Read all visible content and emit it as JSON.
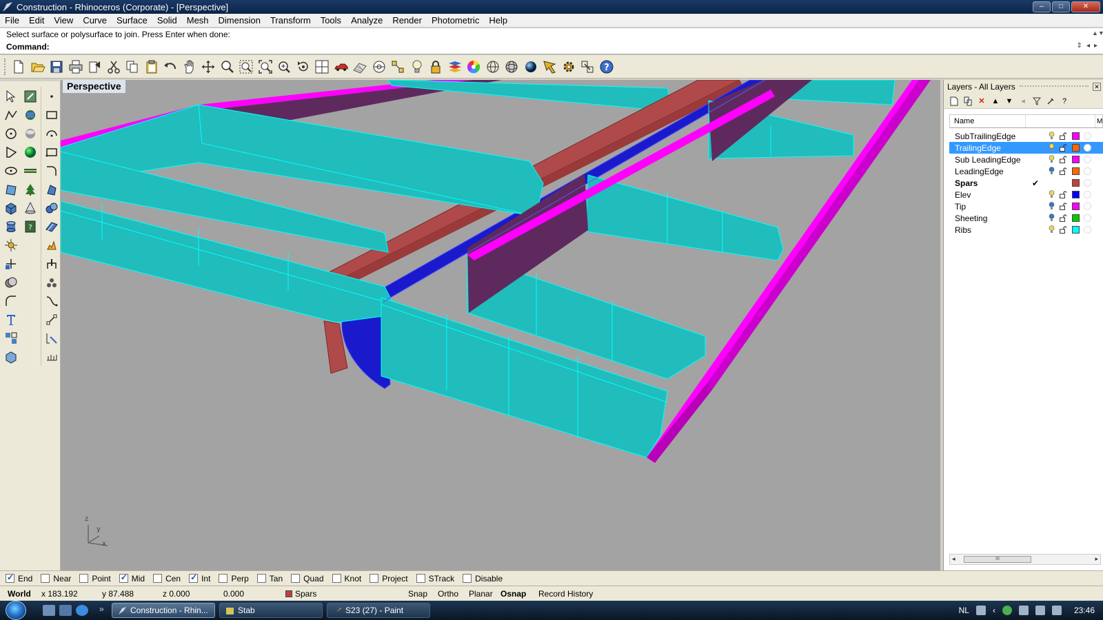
{
  "window": {
    "title": "Construction - Rhinoceros (Corporate) - [Perspective]",
    "controls": [
      "–",
      "□",
      "✕"
    ]
  },
  "menu": [
    "File",
    "Edit",
    "View",
    "Curve",
    "Surface",
    "Solid",
    "Mesh",
    "Dimension",
    "Transform",
    "Tools",
    "Analyze",
    "Render",
    "Photometric",
    "Help"
  ],
  "command": {
    "history": "Select surface or polysurface to join. Press Enter when done:",
    "prompt": "Command:"
  },
  "toolbar_icons": [
    "new-icon",
    "open-icon",
    "save-icon",
    "print-icon",
    "export-icon",
    "cut-icon",
    "copy-icon",
    "paste-icon",
    "undo-icon",
    "pan-hand-icon",
    "rotate-view-icon",
    "zoom-icon",
    "zoom-window-icon",
    "zoom-extents-icon",
    "zoom-selected-icon",
    "undo-view-icon",
    "four-viewports-icon",
    "car-icon",
    "grid-icon",
    "target-icon",
    "select-points-icon",
    "lightbulb-icon",
    "lock-icon",
    "layer-icon",
    "color-wheel-icon",
    "wireframe-sphere-icon",
    "mesh-sphere-icon",
    "render-sphere-icon",
    "analysis-icon",
    "options-gear-icon",
    "snap-icon",
    "help-icon"
  ],
  "viewport": {
    "title": "Perspective",
    "axes": {
      "x": "x",
      "y": "y",
      "z": "z"
    }
  },
  "layers_panel": {
    "title": "Layers - All Layers",
    "column_name": "Name",
    "column_more": "M",
    "layers": [
      {
        "name": "SubTrailingEdge",
        "color": "#ff00ff",
        "bulb": "#e8d85a",
        "selected": false,
        "current": false,
        "check": ""
      },
      {
        "name": "TrailingEdge",
        "color": "#ff6600",
        "bulb": "#e8d85a",
        "selected": true,
        "current": false,
        "check": ""
      },
      {
        "name": "Sub LeadingEdge",
        "color": "#ff00ff",
        "bulb": "#e8d85a",
        "selected": false,
        "current": false,
        "check": ""
      },
      {
        "name": "LeadingEdge",
        "color": "#ff6600",
        "bulb": "#3a78c8",
        "selected": false,
        "current": false,
        "check": ""
      },
      {
        "name": "Spars",
        "color": "#c04040",
        "bulb": "",
        "selected": false,
        "current": true,
        "check": "✔"
      },
      {
        "name": "Elev",
        "color": "#0000ff",
        "bulb": "#e8d85a",
        "selected": false,
        "current": false,
        "check": ""
      },
      {
        "name": "Tip",
        "color": "#ff00ff",
        "bulb": "#3a78c8",
        "selected": false,
        "current": false,
        "check": ""
      },
      {
        "name": "Sheeting",
        "color": "#00cc00",
        "bulb": "#3a78c8",
        "selected": false,
        "current": false,
        "check": ""
      },
      {
        "name": "Ribs",
        "color": "#00ffff",
        "bulb": "#e8d85a",
        "selected": false,
        "current": false,
        "check": ""
      }
    ],
    "scroll_thumb": "III"
  },
  "osnaps": [
    {
      "label": "End",
      "checked": true
    },
    {
      "label": "Near",
      "checked": false
    },
    {
      "label": "Point",
      "checked": false
    },
    {
      "label": "Mid",
      "checked": true
    },
    {
      "label": "Cen",
      "checked": false
    },
    {
      "label": "Int",
      "checked": true
    },
    {
      "label": "Perp",
      "checked": false
    },
    {
      "label": "Tan",
      "checked": false
    },
    {
      "label": "Quad",
      "checked": false
    },
    {
      "label": "Knot",
      "checked": false
    },
    {
      "label": "Project",
      "checked": false
    },
    {
      "label": "STrack",
      "checked": false
    },
    {
      "label": "Disable",
      "checked": false
    }
  ],
  "status": {
    "cplane": "World",
    "x": "x 183.192",
    "y": "y 87.488",
    "z": "z 0.000",
    "distance": "0.000",
    "layer": "Spars",
    "layer_color": "#c04040",
    "snap": "Snap",
    "ortho": "Ortho",
    "planar": "Planar",
    "osnap": "Osnap",
    "record_history": "Record History"
  },
  "taskbar": {
    "tasks": [
      {
        "label": "Construction - Rhin...",
        "active": true
      },
      {
        "label": "Stab",
        "active": false
      },
      {
        "label": "S23 (27) - Paint",
        "active": false
      }
    ],
    "more": "»",
    "locale": "NL",
    "clock": "23:46"
  },
  "colors": {
    "rib": "#21bcbc",
    "rib_edge": "#00ffff",
    "spar": "#b04a4a",
    "trailing_edge": "#ff00ff",
    "trailing_edge_dark": "#5e2a5e",
    "elev": "#1a1acc",
    "viewport_bg": "#a3a3a3"
  }
}
